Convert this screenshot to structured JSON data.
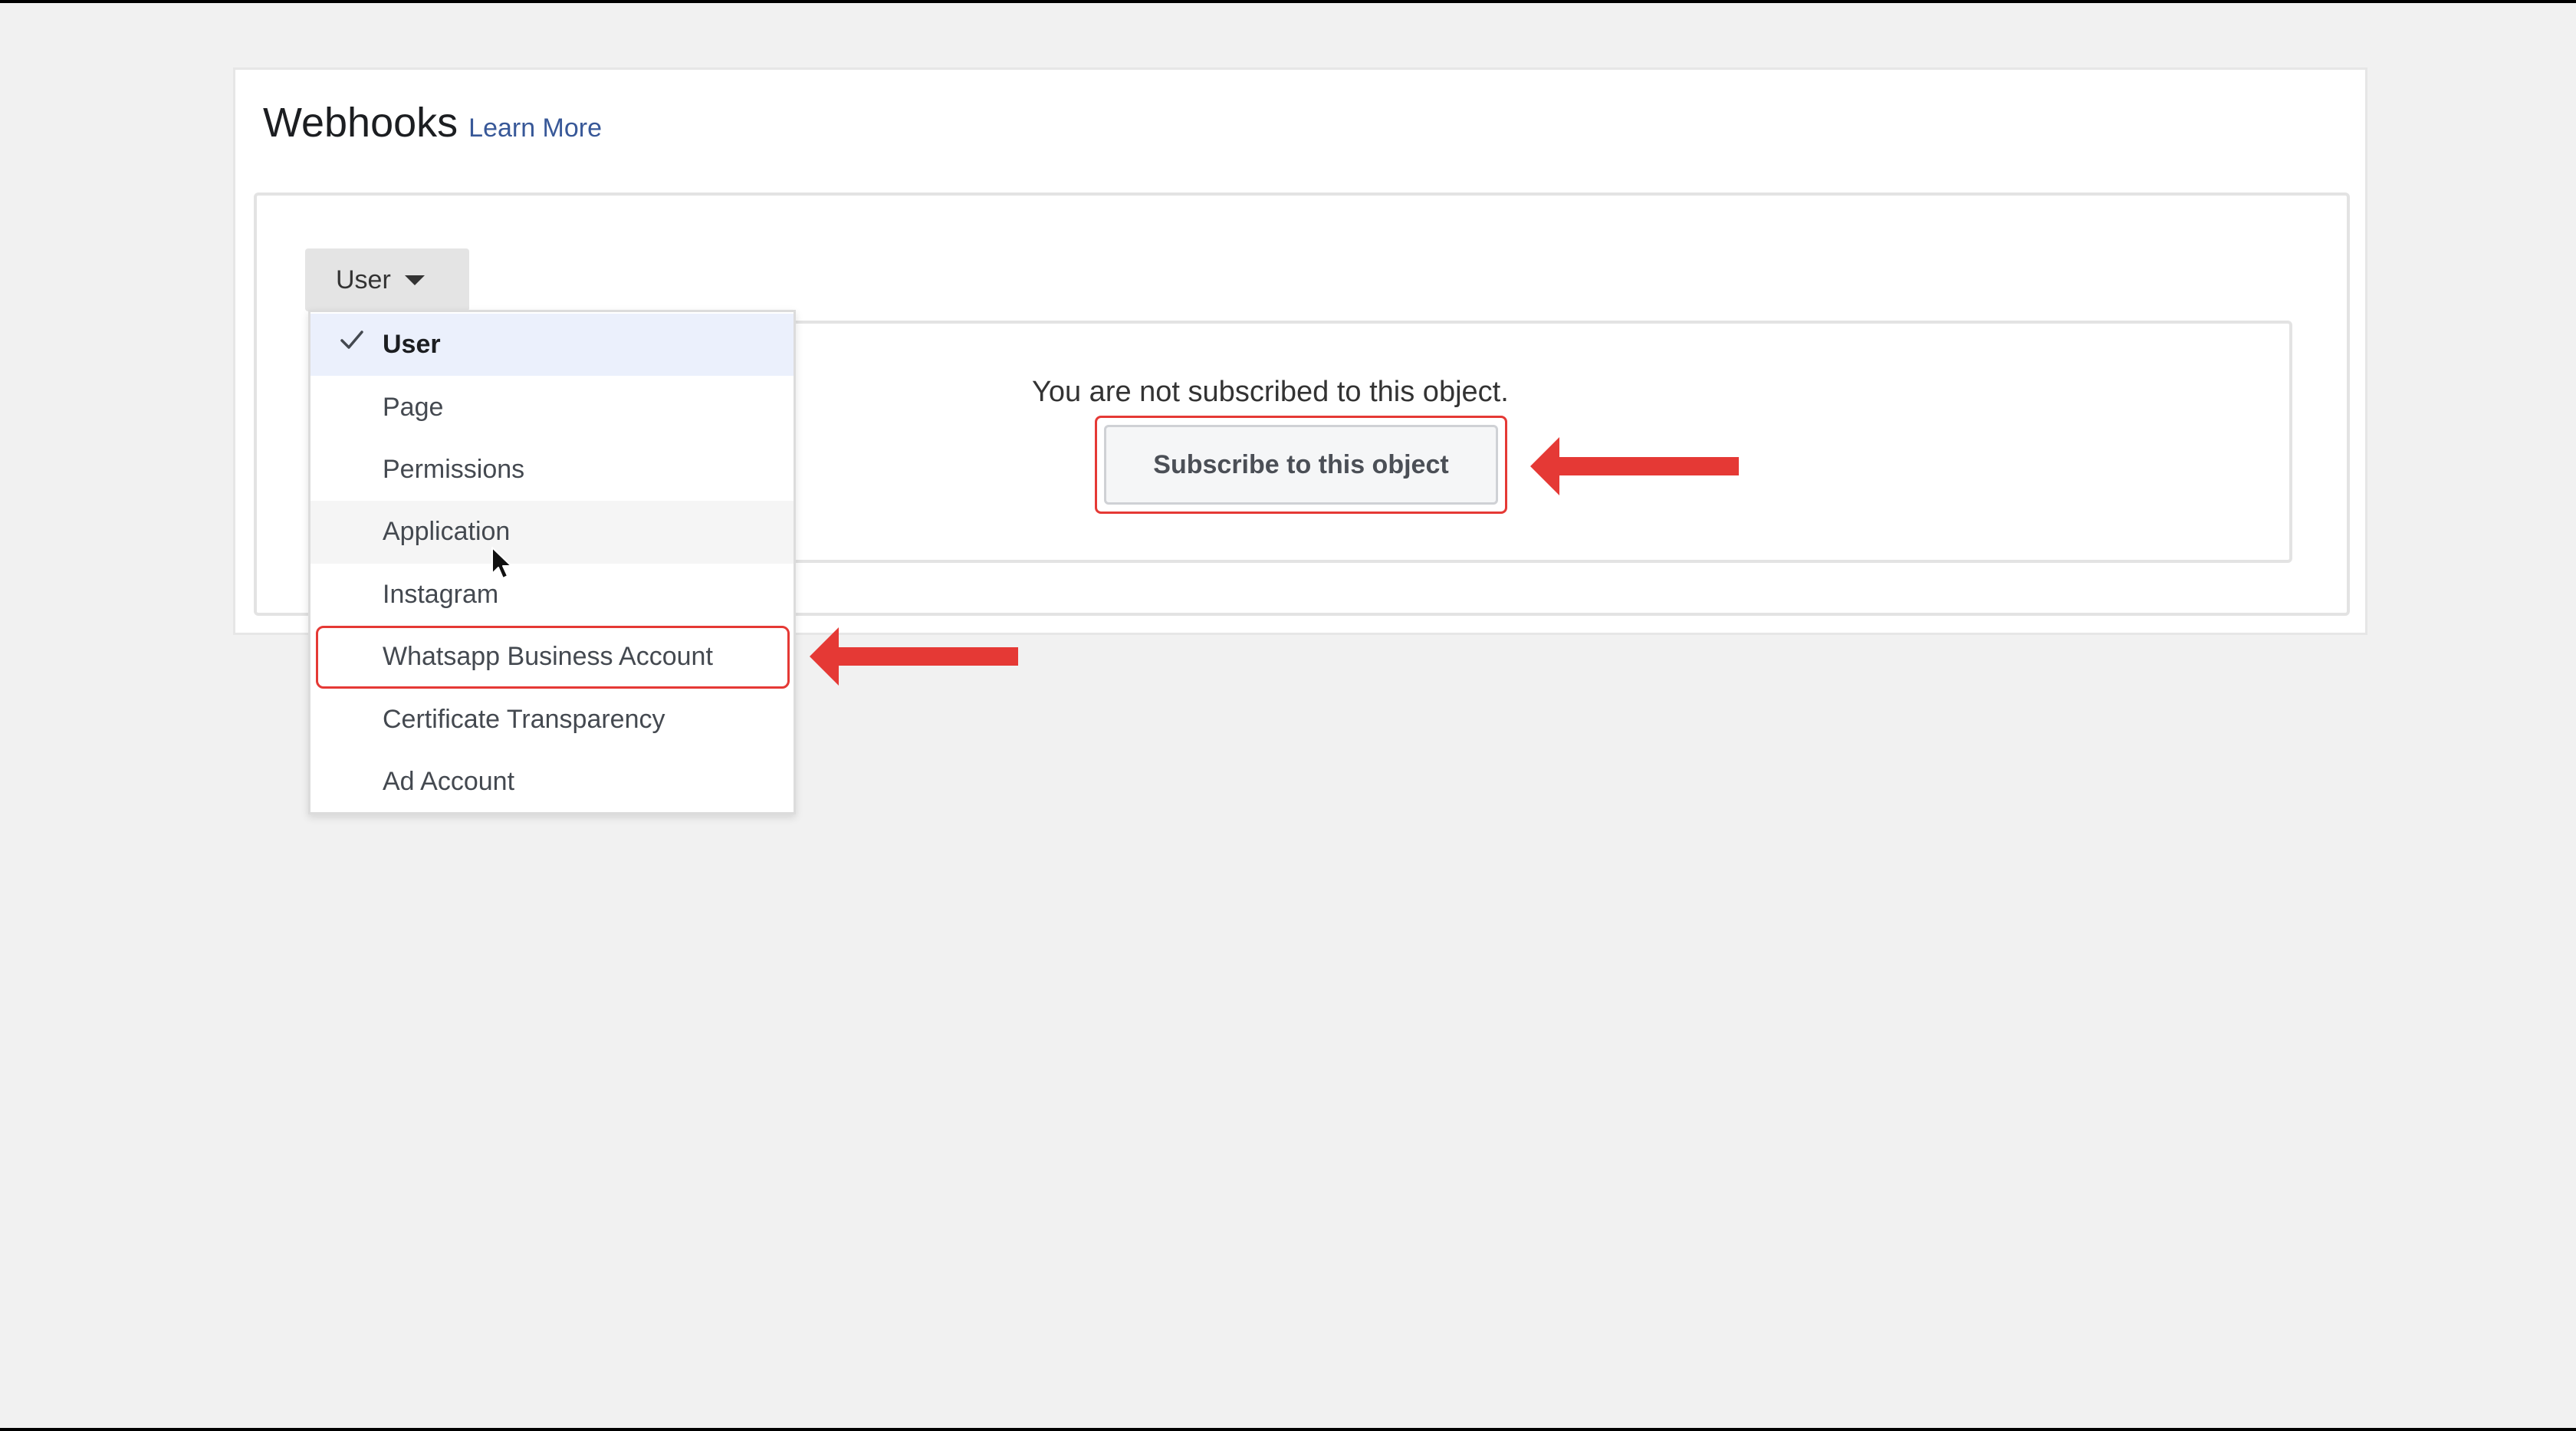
{
  "panel": {
    "title": "Webhooks",
    "learn_more": "Learn More"
  },
  "object_dropdown": {
    "selected_label": "User",
    "options": [
      "User",
      "Page",
      "Permissions",
      "Application",
      "Instagram",
      "Whatsapp Business Account",
      "Certificate Transparency",
      "Ad Account"
    ]
  },
  "subscription": {
    "status_text": "You are not subscribed to this object.",
    "subscribe_label": "Subscribe to this object"
  },
  "colors": {
    "accent_link": "#385898",
    "annotation_red": "#e53935",
    "selected_bg": "#ebf0fc"
  },
  "icons": {
    "check": "checkmark-icon",
    "caret": "caret-down-icon",
    "arrow": "red-arrow-left-icon",
    "cursor": "mouse-pointer-icon"
  }
}
